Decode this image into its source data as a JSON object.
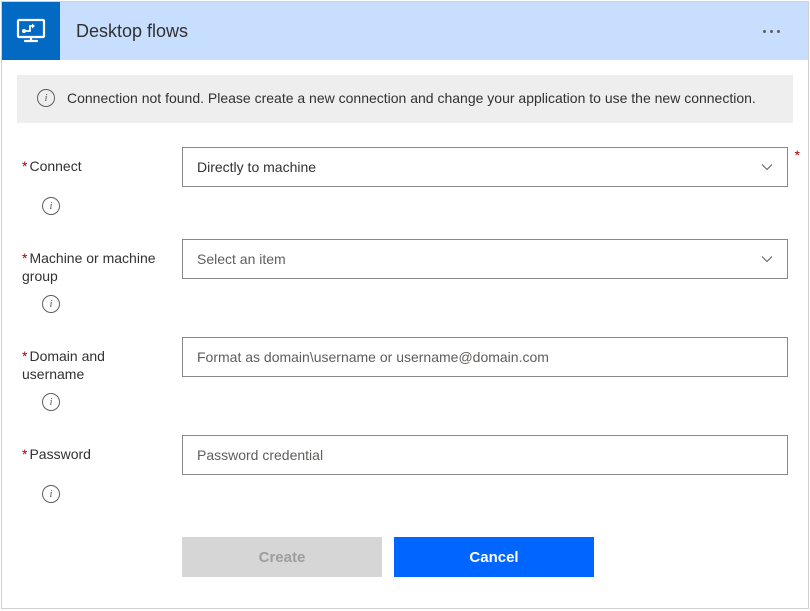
{
  "header": {
    "title": "Desktop flows"
  },
  "warning": {
    "message": "Connection not found. Please create a new connection and change your application to use the new connection."
  },
  "form": {
    "connect": {
      "label": "Connect",
      "value": "Directly to machine"
    },
    "machine": {
      "label": "Machine or machine group",
      "placeholder": "Select an item"
    },
    "domain": {
      "label": "Domain and username",
      "placeholder": "Format as domain\\username or username@domain.com"
    },
    "password": {
      "label": "Password",
      "placeholder": "Password credential"
    }
  },
  "buttons": {
    "create": "Create",
    "cancel": "Cancel"
  }
}
